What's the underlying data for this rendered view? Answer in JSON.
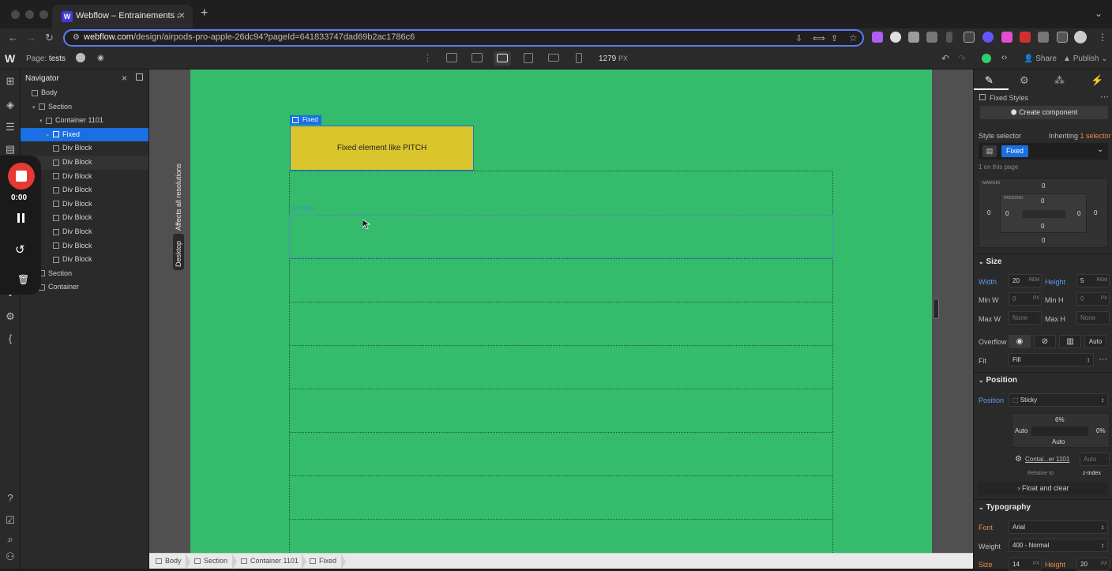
{
  "browser": {
    "tab_title": "Webflow – Entrainements anim",
    "tab_favicon": "W",
    "new_tab": "+",
    "url_domain": "webflow.com",
    "url_path": "/design/airpods-pro-apple-26dc94?pageId=641833747dad69b2ac1786c6"
  },
  "topbar": {
    "logo": "W",
    "page_label": "Page:",
    "page_name": "tests",
    "width_value": "1279",
    "width_unit": "PX",
    "share": "Share",
    "publish": "Publish"
  },
  "recorder": {
    "time": "0:00"
  },
  "navigator": {
    "title": "Navigator",
    "items": [
      {
        "label": "Body",
        "indent": 0,
        "caret": ""
      },
      {
        "label": "Section",
        "indent": 1,
        "caret": "▾"
      },
      {
        "label": "Container 1101",
        "indent": 2,
        "caret": "▾"
      },
      {
        "label": "Fixed",
        "indent": 3,
        "caret": "▸",
        "selected": true
      },
      {
        "label": "Div Block",
        "indent": 3,
        "caret": ""
      },
      {
        "label": "Div Block",
        "indent": 3,
        "caret": "",
        "hover": true
      },
      {
        "label": "Div Block",
        "indent": 3,
        "caret": ""
      },
      {
        "label": "Div Block",
        "indent": 3,
        "caret": ""
      },
      {
        "label": "Div Block",
        "indent": 3,
        "caret": ""
      },
      {
        "label": "Div Block",
        "indent": 3,
        "caret": ""
      },
      {
        "label": "Div Block",
        "indent": 3,
        "caret": ""
      },
      {
        "label": "Div Block",
        "indent": 3,
        "caret": ""
      },
      {
        "label": "Div Block",
        "indent": 3,
        "caret": ""
      },
      {
        "label": "Section",
        "indent": 1,
        "caret": "▸"
      },
      {
        "label": "Container",
        "indent": 1,
        "caret": "▸"
      }
    ]
  },
  "canvas": {
    "vertical_note": "Affects all resolutions",
    "vertical_device": "Desktop",
    "fixed_tag": "Fixed",
    "fixed_text": "Fixed element like PITCH",
    "hover_tag": "Div Block",
    "bg_color": "#34bb6b",
    "fixed_color": "#dbc52c"
  },
  "breadcrumb": [
    "Body",
    "Section",
    "Container 1101",
    "Fixed"
  ],
  "panel": {
    "fixed_styles": "Fixed Styles",
    "create_component": "Create component",
    "style_selector": "Style selector",
    "inheriting": "Inheriting",
    "inheriting_count": "1 selector",
    "selector_chip": "Fixed",
    "on_page": "1 on this page",
    "margin_label": "MARGIN",
    "padding_label": "PADDING",
    "margin": {
      "top": "0",
      "right": "0",
      "bottom": "0",
      "left": "0"
    },
    "padding": {
      "top": "0",
      "right": "0",
      "bottom": "0",
      "left": "0"
    },
    "size_title": "Size",
    "width_label": "Width",
    "width_value": "20",
    "width_unit": "REM",
    "height_label": "Height",
    "height_value": "5",
    "height_unit": "REM",
    "minw_label": "Min W",
    "minw_value": "0",
    "minw_unit": "PX",
    "minh_label": "Min H",
    "minh_value": "0",
    "minh_unit": "PX",
    "maxw_label": "Max W",
    "maxw_value": "None",
    "maxh_label": "Max H",
    "maxh_value": "None",
    "overflow_label": "Overflow",
    "overflow_auto": "Auto",
    "fit_label": "Fit",
    "fit_value": "Fill",
    "position_title": "Position",
    "position_label": "Position",
    "position_value": "Sticky",
    "pos_top": "6%",
    "pos_left": "Auto",
    "pos_right": "0%",
    "pos_bottom": "Auto",
    "relative_target": "Contai...er 1101",
    "relative_to": "Relative to",
    "zindex_value": "Auto",
    "zindex_label": "z-Index",
    "float_clear": "Float and clear",
    "typography_title": "Typography",
    "font_label": "Font",
    "font_value": "Arial",
    "weight_label": "Weight",
    "weight_value": "400 - Normal",
    "size_label": "Size",
    "size_value": "14",
    "size_unit": "PX",
    "lineheight_label": "Height",
    "lineheight_value": "20",
    "lineheight_unit": "PX"
  }
}
